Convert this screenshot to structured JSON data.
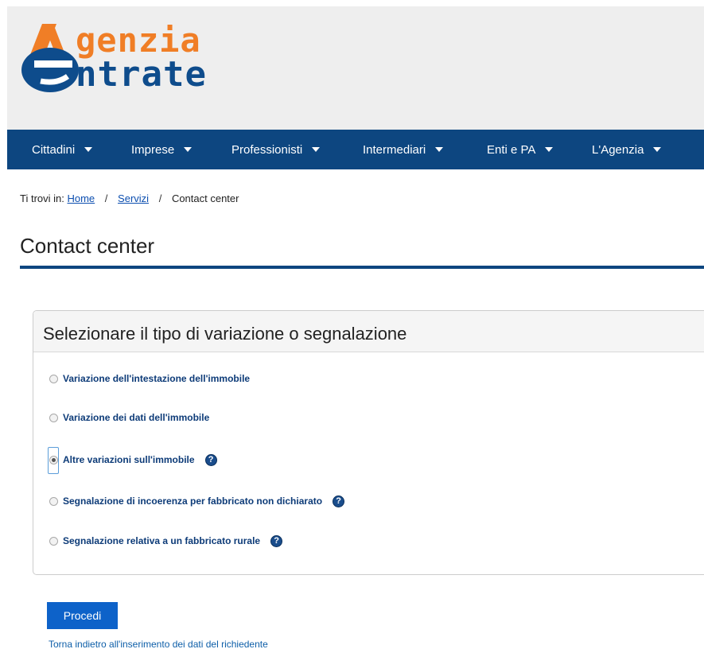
{
  "logo": {
    "line1": "genzia",
    "line2": "ntrate"
  },
  "nav": {
    "items": [
      {
        "label": "Cittadini"
      },
      {
        "label": "Imprese"
      },
      {
        "label": "Professionisti"
      },
      {
        "label": "Intermediari"
      },
      {
        "label": "Enti e PA"
      },
      {
        "label": "L'Agenzia"
      }
    ]
  },
  "breadcrumb": {
    "prefix": "Ti trovi in:",
    "home": "Home",
    "sep": "/",
    "servizi": "Servizi",
    "current": "Contact center"
  },
  "page": {
    "title": "Contact center"
  },
  "form": {
    "heading": "Selezionare il tipo di variazione o segnalazione",
    "options": [
      {
        "label": "Variazione dell'intestazione dell'immobile",
        "checked": false,
        "help": false
      },
      {
        "label": "Variazione dei dati dell'immobile",
        "checked": false,
        "help": false
      },
      {
        "label": "Altre variazioni sull'immobile",
        "checked": true,
        "help": true
      },
      {
        "label": "Segnalazione di incoerenza per fabbricato non dichiarato",
        "checked": false,
        "help": true
      },
      {
        "label": "Segnalazione relativa a un fabbricato rurale",
        "checked": false,
        "help": true
      }
    ],
    "help_glyph": "?",
    "submit_label": "Procedi",
    "back_link": "Torna indietro all'inserimento dei dati del richiedente"
  },
  "colors": {
    "nav_bg": "#0d4680",
    "logo_orange": "#f07e26",
    "logo_blue": "#0e4c8c",
    "button_bg": "#0d62c9",
    "option_text": "#0d3b78"
  },
  "icons": [
    "logo-emblem",
    "caret-down-icon",
    "help-icon",
    "radio-button"
  ]
}
